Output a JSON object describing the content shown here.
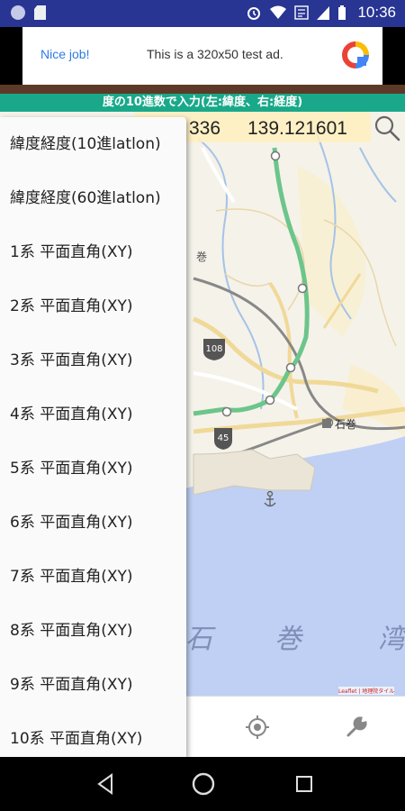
{
  "status_bar": {
    "time": "10:36",
    "icons": [
      "app-dot-icon",
      "sd-card-icon",
      "alarm-icon",
      "wifi-icon",
      "volte-icon",
      "signal-icon",
      "battery-icon"
    ]
  },
  "ad": {
    "nice_job": "Nice job!",
    "text": "This is a 320x50 test ad."
  },
  "instruction_bar": "度の10進数で入力(左:緯度、右:経度)",
  "coordinates": {
    "lat_partial": "336",
    "lon": "139.121601"
  },
  "map": {
    "labels": {
      "maki": "巻",
      "ishinomaki": "石巻",
      "route_108": "108",
      "route_45": "45",
      "bay_chars": [
        "石",
        "巻",
        "湾"
      ],
      "attribution": "Leaflet | 地理院タイル"
    }
  },
  "menu": {
    "items": [
      "緯度経度(10進latlon)",
      "緯度経度(60進latlon)",
      "1系 平面直角(XY)",
      "2系 平面直角(XY)",
      "3系 平面直角(XY)",
      "4系 平面直角(XY)",
      "5系 平面直角(XY)",
      "6系 平面直角(XY)",
      "7系 平面直角(XY)",
      "8系 平面直角(XY)",
      "9系 平面直角(XY)",
      "10系 平面直角(XY)"
    ]
  },
  "toolbar": {
    "locate_icon": "crosshair-icon",
    "settings_icon": "wrench-icon"
  },
  "colors": {
    "status_bar": "#283593",
    "instruction_bar": "#19a98a",
    "rail_line": "#6cc58a",
    "sea": "#bfd0f4"
  }
}
